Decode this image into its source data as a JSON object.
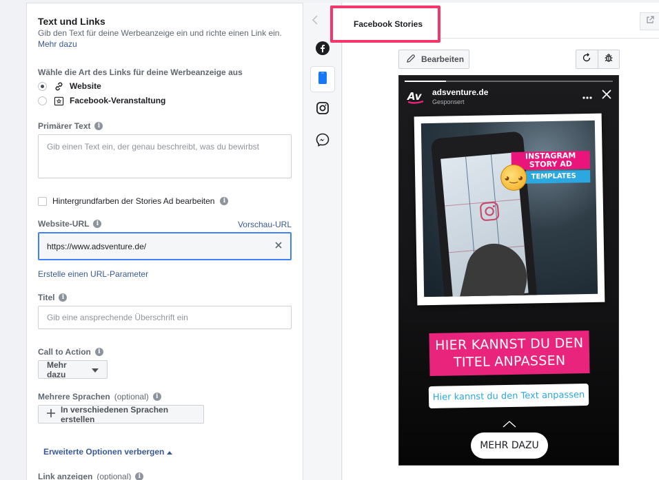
{
  "form": {
    "title": "Text und Links",
    "description": "Gib den Text für deine Werbeanzeige ein und richte einen Link ein.",
    "learn_more": "Mehr dazu",
    "link_type_label": "Wähle die Art des Links für deine Werbeanzeige aus",
    "link_types": [
      {
        "label": "Website",
        "checked": true,
        "icon": "link-icon"
      },
      {
        "label": "Facebook-Veranstaltung",
        "checked": false,
        "icon": "event-star-icon"
      }
    ],
    "primary_text_label": "Primärer Text",
    "primary_text_placeholder": "Gib einen Text ein, der genau beschreibt, was du bewirbst",
    "bg_colors_checkbox": "Hintergrundfarben der Stories Ad bearbeiten",
    "website_url_label": "Website-URL",
    "preview_url": "Vorschau-URL",
    "website_url_value": "https://www.adsventure.de/",
    "url_params_link": "Erstelle einen URL-Parameter",
    "title_label": "Titel",
    "title_placeholder": "Gib eine ansprechende Überschrift ein",
    "cta_label": "Call to Action",
    "cta_value": "Mehr dazu",
    "languages_label": "Mehrere Sprachen",
    "languages_optional": "(optional)",
    "languages_button": "In verschiedenen Sprachen erstellen",
    "advanced_toggle": "Erweiterte Optionen verbergen",
    "display_link_label": "Link anzeigen",
    "display_link_optional": "(optional)"
  },
  "placements": [
    {
      "name": "facebook",
      "icon": "facebook-icon",
      "active": false
    },
    {
      "name": "mobile",
      "icon": "mobile-phone-icon",
      "active": true
    },
    {
      "name": "instagram",
      "icon": "instagram-icon",
      "active": false
    },
    {
      "name": "messenger",
      "icon": "messenger-icon",
      "active": false
    }
  ],
  "preview": {
    "tab_label": "Facebook Stories",
    "edit_button": "Bearbeiten",
    "story": {
      "account_name": "adsventure.de",
      "sponsored": "Gesponsert",
      "badge_line1": "INSTAGRAM",
      "badge_line2": "STORY AD",
      "badge_templates": "TEMPLATES",
      "title_text": "HIER KANNST DU DEN TITEL ANPASSEN",
      "sub_text": "Hier kannst du den Text anpassen",
      "cta": "MEHR DAZU"
    }
  },
  "colors": {
    "accent_link": "#385898",
    "highlight": "#f3376b",
    "story_pink": "#e8247c",
    "story_blue": "#2ba8e0"
  }
}
